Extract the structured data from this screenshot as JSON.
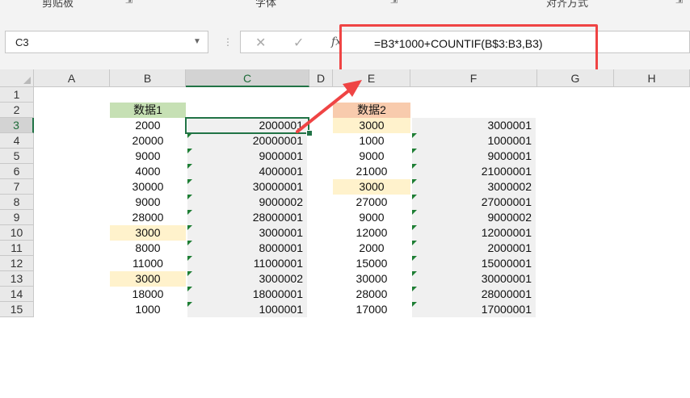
{
  "ribbon": {
    "groups": [
      "剪贴板",
      "字体",
      "对齐方式"
    ],
    "launcher_glyph": "⇲"
  },
  "formula_bar": {
    "name_box": "C3",
    "dots": "⋮",
    "cancel_glyph": "✕",
    "enter_glyph": "✓",
    "fx_label": "fx",
    "formula": "=B3*1000+COUNTIF(B$3:B3,B3)"
  },
  "columns": [
    "A",
    "B",
    "C",
    "D",
    "E",
    "F",
    "G",
    "H"
  ],
  "rows": [
    {
      "num": "1",
      "B": "",
      "C": "",
      "E": "",
      "F": ""
    },
    {
      "num": "2",
      "B": "数据1",
      "C": "",
      "E": "数据2",
      "F": ""
    },
    {
      "num": "3",
      "B": "2000",
      "C": "2000001",
      "E": "3000",
      "F": "3000001"
    },
    {
      "num": "4",
      "B": "20000",
      "C": "20000001",
      "E": "1000",
      "F": "1000001"
    },
    {
      "num": "5",
      "B": "9000",
      "C": "9000001",
      "E": "9000",
      "F": "9000001"
    },
    {
      "num": "6",
      "B": "4000",
      "C": "4000001",
      "E": "21000",
      "F": "21000001"
    },
    {
      "num": "7",
      "B": "30000",
      "C": "30000001",
      "E": "3000",
      "F": "3000002"
    },
    {
      "num": "8",
      "B": "9000",
      "C": "9000002",
      "E": "27000",
      "F": "27000001"
    },
    {
      "num": "9",
      "B": "28000",
      "C": "28000001",
      "E": "9000",
      "F": "9000002"
    },
    {
      "num": "10",
      "B": "3000",
      "C": "3000001",
      "E": "12000",
      "F": "12000001"
    },
    {
      "num": "11",
      "B": "8000",
      "C": "8000001",
      "E": "2000",
      "F": "2000001"
    },
    {
      "num": "12",
      "B": "11000",
      "C": "11000001",
      "E": "15000",
      "F": "15000001"
    },
    {
      "num": "13",
      "B": "3000",
      "C": "3000002",
      "E": "30000",
      "F": "30000001"
    },
    {
      "num": "14",
      "B": "18000",
      "C": "18000001",
      "E": "28000",
      "F": "28000001"
    },
    {
      "num": "15",
      "B": "1000",
      "C": "1000001",
      "E": "17000",
      "F": "17000001"
    }
  ],
  "active_cell": "C3",
  "colors": {
    "header_green": "#c6e0b4",
    "header_orange": "#f8cbad",
    "duplicate_highlight": "#fff2cc",
    "helper_column_grey": "#f0f0f0",
    "selection_green": "#217346",
    "callout_red": "#ef4444"
  }
}
